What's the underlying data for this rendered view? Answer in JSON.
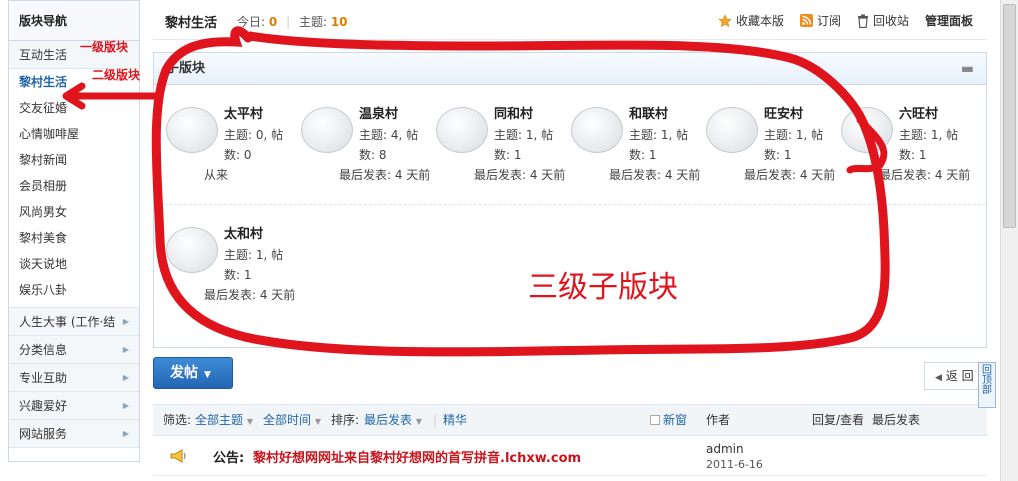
{
  "sidebar": {
    "title": "版块导航",
    "level1_cat": "互动生活",
    "subitems": [
      "黎村生活",
      "交友征婚",
      "心情咖啡屋",
      "黎村新闻",
      "会员相册",
      "风尚男女",
      "黎村美食",
      "谈天说地",
      "娱乐八卦"
    ],
    "active_index": 0,
    "categories": [
      "人生大事 (工作·结",
      "分类信息",
      "专业互助",
      "兴趣爱好",
      "网站服务"
    ]
  },
  "header": {
    "forum_name": "黎村生活",
    "today_label": "今日:",
    "today_value": "0",
    "topics_label": "主题:",
    "topics_value": "10",
    "tools": {
      "favorite": "收藏本版",
      "subscribe": "订阅",
      "recycle": "回收站",
      "admin": "管理面板"
    }
  },
  "subboards": {
    "title": "子版块",
    "row1": [
      {
        "name": "太平村",
        "info": "主题: 0, 帖数: 0",
        "last": "从来"
      },
      {
        "name": "温泉村",
        "info": "主题: 4, 帖数: 8",
        "last": "最后发表: 4 天前"
      },
      {
        "name": "同和村",
        "info": "主题: 1, 帖数: 1",
        "last": "最后发表: 4 天前"
      },
      {
        "name": "和联村",
        "info": "主题: 1, 帖数: 1",
        "last": "最后发表: 4 天前"
      },
      {
        "name": "旺安村",
        "info": "主题: 1, 帖数: 1",
        "last": "最后发表: 4 天前"
      },
      {
        "name": "六旺村",
        "info": "主题: 1, 帖数: 1",
        "last": "最后发表: 4 天前"
      }
    ],
    "row2": [
      {
        "name": "太和村",
        "info": "主题: 1, 帖数: 1",
        "last": "最后发表: 4 天前"
      }
    ]
  },
  "actions": {
    "post": "发帖",
    "back": "返 回",
    "back_top": "回顶部"
  },
  "filter": {
    "label": "筛选:",
    "all_topics": "全部主题",
    "all_time": "全部时间",
    "sort_label": "排序:",
    "sort_value": "最后发表",
    "digest": "精华",
    "new_window": "新窗",
    "col_author": "作者",
    "col_replies": "回复/查看",
    "col_last": "最后发表"
  },
  "notice": {
    "label": "公告:",
    "title": "黎村好想网网址来自黎村好想网的首写拼音.lchxw.com",
    "author": "admin",
    "date": "2011-6-16"
  },
  "annotations": {
    "level1": "一级版块",
    "level2": "二级版块",
    "level3": "三级子版块",
    "color": "#e0141c"
  }
}
